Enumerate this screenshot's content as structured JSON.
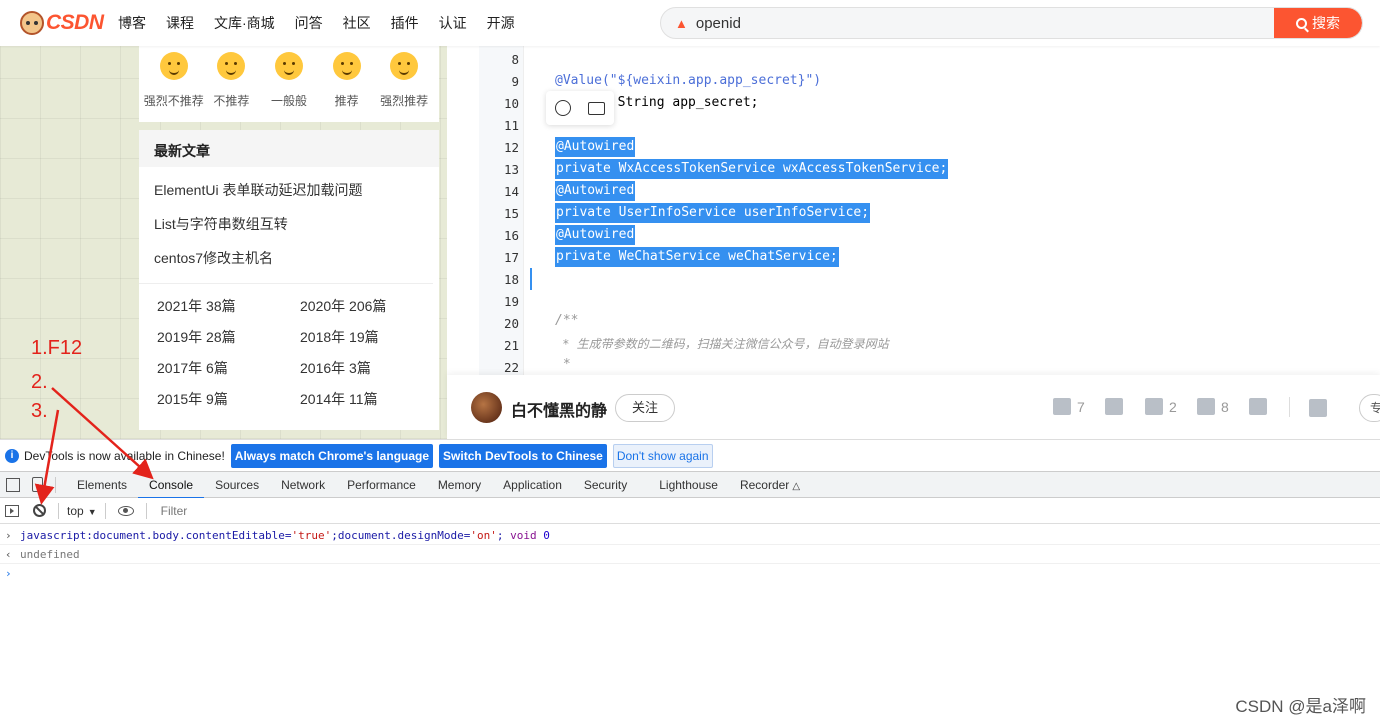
{
  "topbar": {
    "logo_text": "CSDN",
    "nav": [
      "博客",
      "课程",
      "文库·商城",
      "问答",
      "社区",
      "插件",
      "认证",
      "开源"
    ],
    "search_query": "openid",
    "search_button": "搜索"
  },
  "rating": {
    "options": [
      "强烈不推荐",
      "不推荐",
      "一般般",
      "推荐",
      "强烈推荐"
    ]
  },
  "latest": {
    "title": "最新文章",
    "articles": [
      "ElementUi 表单联动延迟加载问题",
      "List与字符串数组互转",
      "centos7修改主机名"
    ],
    "archive": [
      "2021年  38篇",
      "2020年  206篇",
      "2019年  28篇",
      "2018年  19篇",
      "2017年  6篇",
      "2016年  3篇",
      "2015年  9篇",
      "2014年  11篇"
    ]
  },
  "code": {
    "lines": [
      {
        "n": "8",
        "text": ""
      },
      {
        "n": "9",
        "text": "@Value(\"${weixin.app.app_secret}\")"
      },
      {
        "n": "10",
        "text": "private String app_secret;"
      },
      {
        "n": "11",
        "text": ""
      },
      {
        "n": "12",
        "text": "@Autowired"
      },
      {
        "n": "13",
        "text": "private WxAccessTokenService wxAccessTokenService;"
      },
      {
        "n": "14",
        "text": "@Autowired"
      },
      {
        "n": "15",
        "text": "private UserInfoService userInfoService;"
      },
      {
        "n": "16",
        "text": "@Autowired"
      },
      {
        "n": "17",
        "text": "private WeChatService weChatService;"
      },
      {
        "n": "18",
        "text": ""
      },
      {
        "n": "19",
        "text": ""
      },
      {
        "n": "20",
        "text": "/**"
      },
      {
        "n": "21",
        "text": " * 生成带参数的二维码，扫描关注微信公众号，自动登录网站"
      },
      {
        "n": "22",
        "text": " *"
      }
    ]
  },
  "author": {
    "name": "白不懂黑的静",
    "follow_label": "关注",
    "likes": "7",
    "comments": "2",
    "favorites": "8",
    "edge_label": "专"
  },
  "devtools": {
    "info_message": "DevTools is now available in Chinese!",
    "btn_match": "Always match Chrome's language",
    "btn_switch": "Switch DevTools to Chinese",
    "btn_dismiss": "Don't show again",
    "tabs": [
      "Elements",
      "Console",
      "Sources",
      "Network",
      "Performance",
      "Memory",
      "Application",
      "Security",
      "Lighthouse",
      "Recorder"
    ],
    "active_tab": "Console",
    "context": "top",
    "filter_placeholder": "Filter",
    "console": {
      "cmd_prefix": "javascript:document.body.contentEditable=",
      "cmd_str1": "'true'",
      "cmd_mid": ";document.designMode=",
      "cmd_str2": "'on'",
      "cmd_sep": "; ",
      "cmd_kw": "void",
      "cmd_num": "0",
      "result": "undefined"
    }
  },
  "annotations": {
    "step1": "1.F12",
    "step2": "2.",
    "step3": "3.",
    "color": "#e3231b"
  },
  "watermark": "CSDN @是a泽啊"
}
